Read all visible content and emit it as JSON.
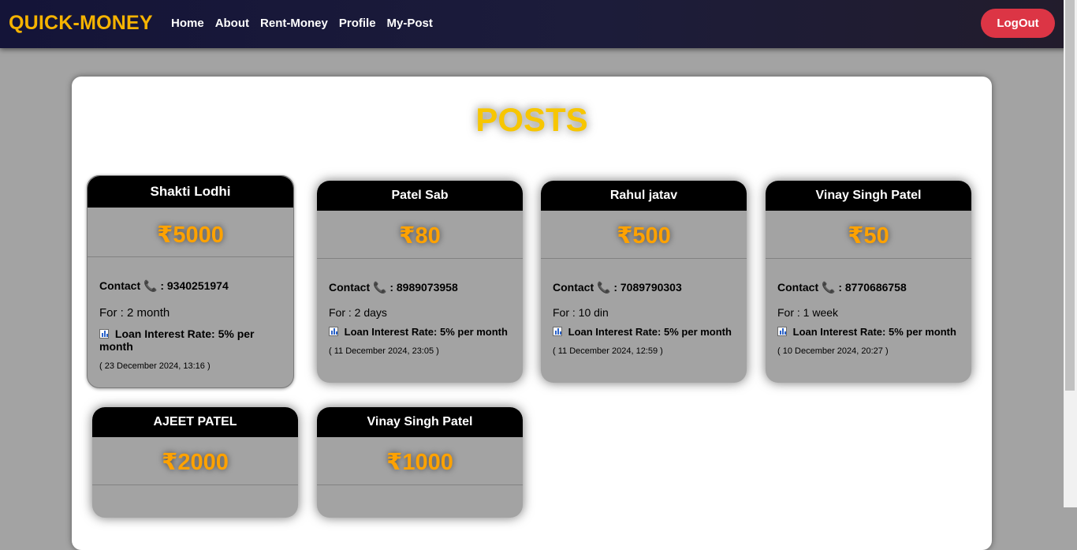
{
  "navbar": {
    "brand": "QUICK-MONEY",
    "links": [
      "Home",
      "About",
      "Rent-Money",
      "Profile",
      "My-Post"
    ],
    "logout_label": "LogOut"
  },
  "page": {
    "title": "POSTS"
  },
  "labels": {
    "contact": "Contact",
    "phone_icon": "📞",
    "rate_prefix": "Loan Interest Rate:"
  },
  "posts": [
    {
      "name": "Shakti Lodhi",
      "amount": "₹5000",
      "contact": ": 9340251974",
      "duration": "For : 2 month",
      "rate": "5% per month",
      "date": "( 23 December 2024, 13:16 )"
    },
    {
      "name": "Patel Sab",
      "amount": "₹80",
      "contact": ": 8989073958",
      "duration": "For : 2 days",
      "rate": "5% per month",
      "date": "( 11 December 2024, 23:05 )"
    },
    {
      "name": "Rahul jatav",
      "amount": "₹500",
      "contact": ": 7089790303",
      "duration": "For : 10 din",
      "rate": "5% per month",
      "date": "( 11 December 2024, 12:59 )"
    },
    {
      "name": "Vinay Singh Patel",
      "amount": "₹50",
      "contact": ": 8770686758",
      "duration": "For : 1 week",
      "rate": "5% per month",
      "date": "( 10 December 2024, 20:27 )"
    },
    {
      "name": "AJEET PATEL",
      "amount": "₹2000"
    },
    {
      "name": "Vinay Singh Patel",
      "amount": "₹1000"
    }
  ]
}
